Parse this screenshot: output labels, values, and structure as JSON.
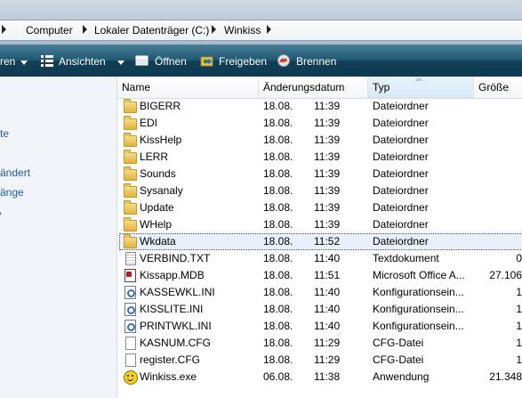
{
  "breadcrumb": {
    "items": [
      "Computer",
      "Lokaler Datenträger (C:)",
      "Winkiss"
    ]
  },
  "toolbar": {
    "organize_partial": "ren",
    "views": "Ansichten",
    "open": "Öffnen",
    "share": "Freigeben",
    "burn": "Brennen"
  },
  "nav": {
    "links": [
      "te",
      "ändert",
      "änge"
    ]
  },
  "columns": {
    "name": "Name",
    "modified": "Änderungsdatum",
    "type": "Typ",
    "size": "Größe"
  },
  "files": [
    {
      "name": "BIGERR",
      "date": "18.08.",
      "time": "11:39",
      "type": "Dateiordner",
      "size": "",
      "icon": "folder-icon"
    },
    {
      "name": "EDI",
      "date": "18.08.",
      "time": "11:39",
      "type": "Dateiordner",
      "size": "",
      "icon": "folder-icon"
    },
    {
      "name": "KissHelp",
      "date": "18.08.",
      "time": "11:39",
      "type": "Dateiordner",
      "size": "",
      "icon": "folder-icon"
    },
    {
      "name": "LERR",
      "date": "18.08.",
      "time": "11:39",
      "type": "Dateiordner",
      "size": "",
      "icon": "folder-icon"
    },
    {
      "name": "Sounds",
      "date": "18.08.",
      "time": "11:39",
      "type": "Dateiordner",
      "size": "",
      "icon": "folder-icon"
    },
    {
      "name": "Sysanaly",
      "date": "18.08.",
      "time": "11:39",
      "type": "Dateiordner",
      "size": "",
      "icon": "folder-icon"
    },
    {
      "name": "Update",
      "date": "18.08.",
      "time": "11:39",
      "type": "Dateiordner",
      "size": "",
      "icon": "folder-icon"
    },
    {
      "name": "WHelp",
      "date": "18.08.",
      "time": "11:39",
      "type": "Dateiordner",
      "size": "",
      "icon": "folder-icon"
    },
    {
      "name": "Wkdata",
      "date": "18.08.",
      "time": "11:52",
      "type": "Dateiordner",
      "size": "",
      "icon": "folder-icon",
      "focused": true
    },
    {
      "name": "VERBIND.TXT",
      "date": "18.08.",
      "time": "11:40",
      "type": "Textdokument",
      "size": "0",
      "icon": "text-file-icon"
    },
    {
      "name": "Kissapp.MDB",
      "date": "18.08.",
      "time": "11:51",
      "type": "Microsoft Office A...",
      "size": "27.106",
      "icon": "database-file-icon"
    },
    {
      "name": "KASSEWKL.INI",
      "date": "18.08.",
      "time": "11:40",
      "type": "Konfigurationsein...",
      "size": "1",
      "icon": "config-file-icon"
    },
    {
      "name": "KISSLITE.INI",
      "date": "18.08.",
      "time": "11:40",
      "type": "Konfigurationsein...",
      "size": "1",
      "icon": "config-file-icon"
    },
    {
      "name": "PRINTWKL.INI",
      "date": "18.08.",
      "time": "11:40",
      "type": "Konfigurationsein...",
      "size": "1",
      "icon": "config-file-icon"
    },
    {
      "name": "KASNUM.CFG",
      "date": "18.08.",
      "time": "11:29",
      "type": "CFG-Datei",
      "size": "1",
      "icon": "file-icon"
    },
    {
      "name": "register.CFG",
      "date": "18.08.",
      "time": "11:29",
      "type": "CFG-Datei",
      "size": "1",
      "icon": "file-icon"
    },
    {
      "name": "Winkiss.exe",
      "date": "06.08.",
      "time": "11:38",
      "type": "Anwendung",
      "size": "21.348",
      "icon": "smiley-app-icon"
    }
  ],
  "colors": {
    "command_bar": "#1d5570",
    "nav_link": "#1e5aa8",
    "folder": "#e3b339"
  }
}
